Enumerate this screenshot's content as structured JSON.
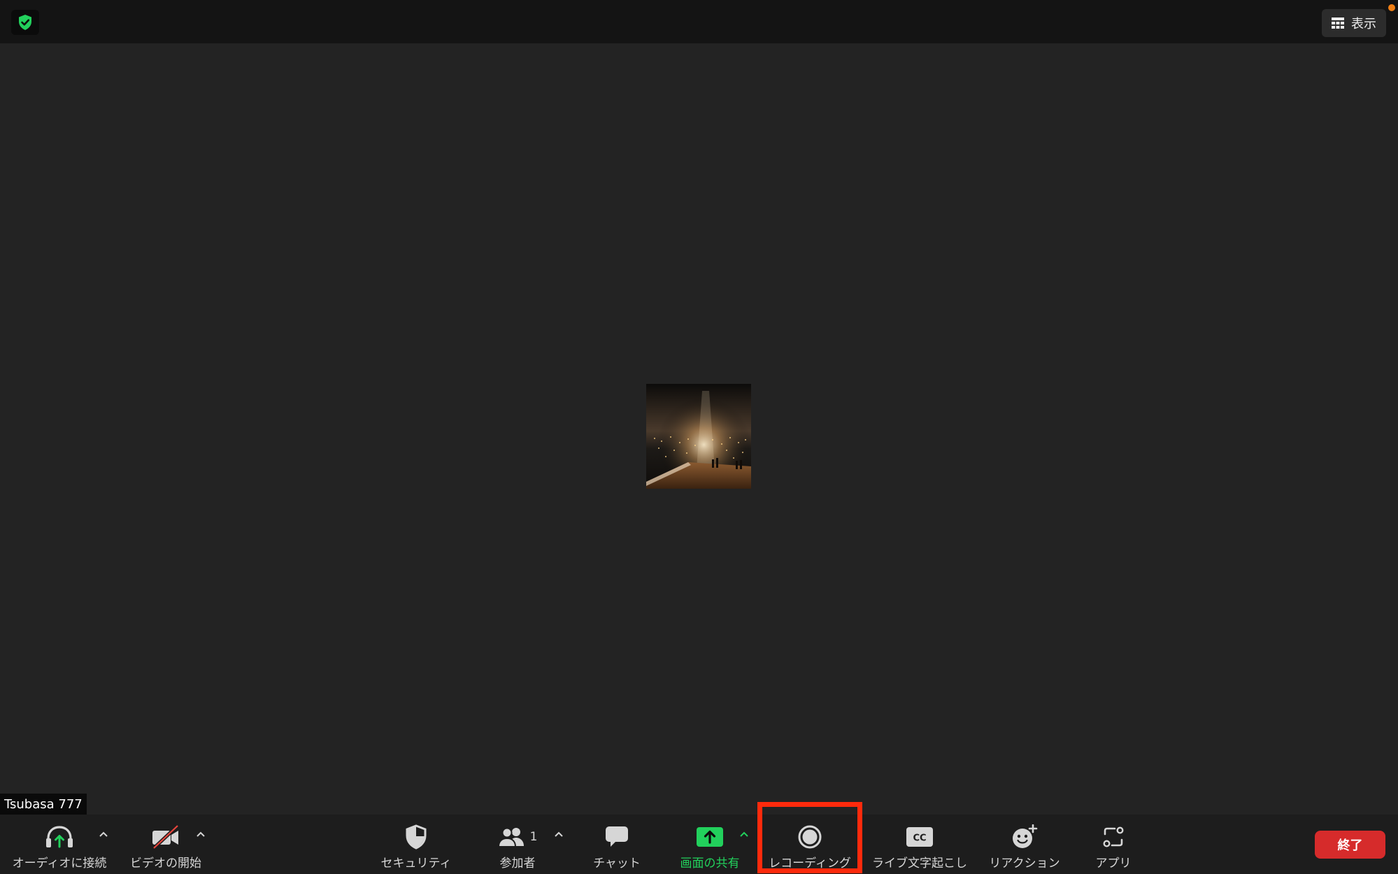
{
  "topbar": {
    "view_label": "表示",
    "shield_icon": "shield-check-icon",
    "accent_green": "#22d05c",
    "notification_color": "#f07f15"
  },
  "video": {
    "participant_name": "Tsubasa 777"
  },
  "toolbar": {
    "audio_label": "オーディオに接続",
    "video_label": "ビデオの開始",
    "security_label": "セキュリティ",
    "participants_label": "参加者",
    "participants_count": "1",
    "chat_label": "チャット",
    "share_label": "画面の共有",
    "record_label": "レコーディング",
    "captions_label": "ライブ文字起こし",
    "captions_icon_text": "CC",
    "reactions_label": "リアクション",
    "apps_label": "アプリ",
    "end_label": "終了",
    "end_color": "#d62b2b",
    "highlight_color": "#ff2a0c"
  }
}
